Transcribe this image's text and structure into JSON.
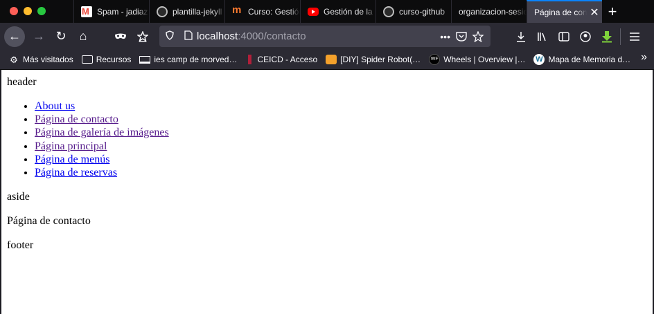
{
  "tabs": [
    {
      "title": "Spam - jadiaz",
      "icon": "gmail-icon",
      "active": false
    },
    {
      "title": "plantilla-jekyll",
      "icon": "github-icon",
      "active": false
    },
    {
      "title": "Curso: Gestión",
      "icon": "domestika-icon",
      "active": false
    },
    {
      "title": "Gestión de la",
      "icon": "youtube-icon",
      "active": false
    },
    {
      "title": "curso-github",
      "icon": "github-icon",
      "active": false
    },
    {
      "title": "organizacion-sesiones",
      "icon": "",
      "active": false
    },
    {
      "title": "Página de contacto",
      "icon": "",
      "active": true
    }
  ],
  "toolbar": {
    "url_host": "localhost",
    "url_path": ":4000/contacto",
    "back_glyph": "←",
    "forward_glyph": "→",
    "reload_glyph": "↻",
    "home_glyph": "⌂",
    "close_tab_glyph": "✕",
    "new_tab_glyph": "+"
  },
  "bookmarks": [
    {
      "label": "Más visitados",
      "icon": "gear-icon"
    },
    {
      "label": "Recursos",
      "icon": "folder-icon"
    },
    {
      "label": "ies camp de morved…",
      "icon": "laptop-icon"
    },
    {
      "label": "CEICD - Acceso",
      "icon": "ceicd-icon"
    },
    {
      "label": "[DIY] Spider Robot(…",
      "icon": "spider-icon"
    },
    {
      "label": "Wheels | Overview |…",
      "icon": "wf-icon"
    },
    {
      "label": "Mapa de Memoria d…",
      "icon": "wordpress-icon"
    }
  ],
  "page": {
    "header": "header",
    "nav_links": [
      {
        "label": "About us",
        "visited": false
      },
      {
        "label": "Página de contacto",
        "visited": true
      },
      {
        "label": "Página de galería de imágenes",
        "visited": true
      },
      {
        "label": "Página principal",
        "visited": true
      },
      {
        "label": "Página de menús",
        "visited": false
      },
      {
        "label": "Página de reservas",
        "visited": false
      }
    ],
    "aside": "aside",
    "main": "Página de contacto",
    "footer": "footer"
  },
  "colors": {
    "link": "#0000ee",
    "visited_link": "#551a8b",
    "active_tab_accent": "#0a84ff",
    "download_indicator": "#7fd13b"
  }
}
